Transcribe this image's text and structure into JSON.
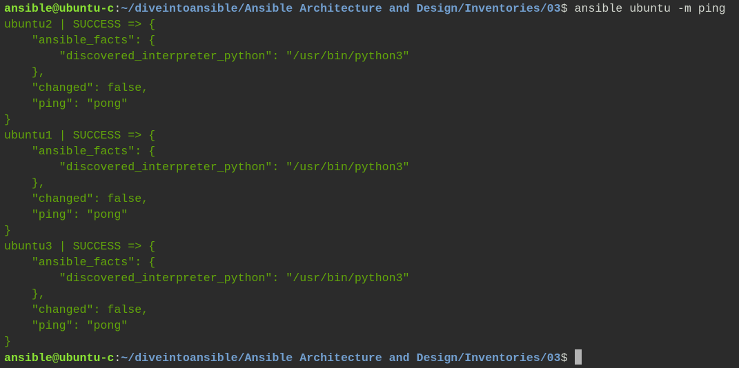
{
  "prompt": {
    "user_host": "ansible@ubuntu-c",
    "colon": ":",
    "path": "~/diveintoansible/Ansible Architecture and Design/Inventories/03",
    "symbol": "$ "
  },
  "command": "ansible ubuntu -m ping",
  "output": [
    "ubuntu2 | SUCCESS => {",
    "    \"ansible_facts\": {",
    "        \"discovered_interpreter_python\": \"/usr/bin/python3\"",
    "    },",
    "    \"changed\": false,",
    "    \"ping\": \"pong\"",
    "}",
    "ubuntu1 | SUCCESS => {",
    "    \"ansible_facts\": {",
    "        \"discovered_interpreter_python\": \"/usr/bin/python3\"",
    "    },",
    "    \"changed\": false,",
    "    \"ping\": \"pong\"",
    "}",
    "ubuntu3 | SUCCESS => {",
    "    \"ansible_facts\": {",
    "        \"discovered_interpreter_python\": \"/usr/bin/python3\"",
    "    },",
    "    \"changed\": false,",
    "    \"ping\": \"pong\"",
    "}"
  ],
  "colors": {
    "background": "#2b2b2b",
    "user_host": "#8ae234",
    "path": "#729fcf",
    "output": "#62a60a",
    "text": "#d3d7cf"
  }
}
